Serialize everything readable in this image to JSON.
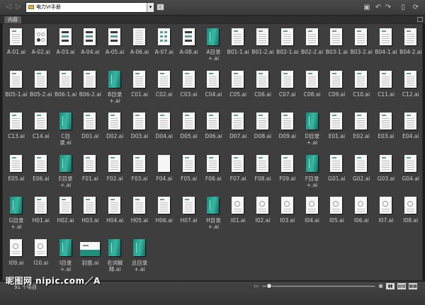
{
  "toolbar": {
    "back_icon": "back-arrow-icon",
    "forward_icon": "forward-arrow-icon",
    "path_value": "电力VI手册",
    "dropdown_glyph": "▾",
    "icons": [
      "new-folder-icon",
      "rotate-left-icon",
      "rotate-right-icon",
      "delete-icon",
      "refresh-icon"
    ]
  },
  "panel": {
    "tab_label": "内容"
  },
  "items": [
    {
      "name": "A-01.ai",
      "kind": "doc"
    },
    {
      "name": "A-02.ai",
      "kind": "circles"
    },
    {
      "name": "A-03.ai",
      "kind": "mini"
    },
    {
      "name": "A-04.ai",
      "kind": "mini"
    },
    {
      "name": "A-05.ai",
      "kind": "mini"
    },
    {
      "name": "A-06.ai",
      "kind": "lines"
    },
    {
      "name": "A-07.ai",
      "kind": "grid"
    },
    {
      "name": "A-08.ai",
      "kind": "mini"
    },
    {
      "name": "A目录\n+.ai",
      "kind": "teal"
    },
    {
      "name": "B01-1.ai",
      "kind": "doc"
    },
    {
      "name": "B01-2.ai",
      "kind": "doc"
    },
    {
      "name": "B02-1.ai",
      "kind": "doc"
    },
    {
      "name": "B02-2.ai",
      "kind": "doc"
    },
    {
      "name": "B03-1.ai",
      "kind": "doc"
    },
    {
      "name": "B03-2.ai",
      "kind": "doc"
    },
    {
      "name": "B04-1.ai",
      "kind": "doc"
    },
    {
      "name": "B04-2.ai",
      "kind": "doc"
    },
    {
      "name": "B05-1.ai",
      "kind": "doc"
    },
    {
      "name": "B05-2.ai",
      "kind": "doc"
    },
    {
      "name": "B06-1.ai",
      "kind": "doc"
    },
    {
      "name": "B06-2.ai",
      "kind": "doc"
    },
    {
      "name": "B目录\n+.ai",
      "kind": "teal"
    },
    {
      "name": "C01.ai",
      "kind": "doc"
    },
    {
      "name": "C02.ai",
      "kind": "doc"
    },
    {
      "name": "C03.ai",
      "kind": "doc"
    },
    {
      "name": "C04.ai",
      "kind": "doc"
    },
    {
      "name": "C05.ai",
      "kind": "doc"
    },
    {
      "name": "C06.ai",
      "kind": "doc"
    },
    {
      "name": "C07.ai",
      "kind": "doc"
    },
    {
      "name": "C08.ai",
      "kind": "doc"
    },
    {
      "name": "C09.ai",
      "kind": "doc"
    },
    {
      "name": "C10.ai",
      "kind": "doc"
    },
    {
      "name": "C11.ai",
      "kind": "doc"
    },
    {
      "name": "C12.ai",
      "kind": "doc"
    },
    {
      "name": "C13.ai",
      "kind": "doc"
    },
    {
      "name": "C14.ai",
      "kind": "doc"
    },
    {
      "name": "C目\n录.ai",
      "kind": "teal"
    },
    {
      "name": "D01.ai",
      "kind": "doc"
    },
    {
      "name": "D02.ai",
      "kind": "doc"
    },
    {
      "name": "D03.ai",
      "kind": "doc"
    },
    {
      "name": "D04.ai",
      "kind": "doc"
    },
    {
      "name": "D05.ai",
      "kind": "doc"
    },
    {
      "name": "D06.ai",
      "kind": "doc"
    },
    {
      "name": "D07.ai",
      "kind": "doc"
    },
    {
      "name": "D08.ai",
      "kind": "doc"
    },
    {
      "name": "D09.ai",
      "kind": "doc"
    },
    {
      "name": "D目录\n+.ai",
      "kind": "teal"
    },
    {
      "name": "E01.ai",
      "kind": "doc"
    },
    {
      "name": "E02.ai",
      "kind": "doc"
    },
    {
      "name": "E03.ai",
      "kind": "doc"
    },
    {
      "name": "E04.ai",
      "kind": "doc"
    },
    {
      "name": "E05.ai",
      "kind": "doc"
    },
    {
      "name": "E06.ai",
      "kind": "doc"
    },
    {
      "name": "E目录\n+.ai",
      "kind": "teal"
    },
    {
      "name": "F01.ai",
      "kind": "doc"
    },
    {
      "name": "F02.ai",
      "kind": "doc"
    },
    {
      "name": "F03.ai",
      "kind": "doc"
    },
    {
      "name": "F04.ai",
      "kind": "blank"
    },
    {
      "name": "F05.ai",
      "kind": "doc"
    },
    {
      "name": "F06.ai",
      "kind": "doc"
    },
    {
      "name": "F07.ai",
      "kind": "doc"
    },
    {
      "name": "F08.ai",
      "kind": "doc"
    },
    {
      "name": "F09.ai",
      "kind": "doc"
    },
    {
      "name": "F目录\n+.ai",
      "kind": "teal"
    },
    {
      "name": "G01.ai",
      "kind": "doc"
    },
    {
      "name": "G02.ai",
      "kind": "doc"
    },
    {
      "name": "G03.ai",
      "kind": "doc"
    },
    {
      "name": "G04.ai",
      "kind": "doc"
    },
    {
      "name": "G目录\n+.ai",
      "kind": "teal"
    },
    {
      "name": "H01.ai",
      "kind": "doc"
    },
    {
      "name": "H02.ai",
      "kind": "doc"
    },
    {
      "name": "H03.ai",
      "kind": "doc"
    },
    {
      "name": "H04.ai",
      "kind": "doc"
    },
    {
      "name": "H05.ai",
      "kind": "doc"
    },
    {
      "name": "H06.ai",
      "kind": "doc"
    },
    {
      "name": "H07.ai",
      "kind": "doc"
    },
    {
      "name": "H目录\n+.ai",
      "kind": "teal"
    },
    {
      "name": "I01.ai",
      "kind": "sketch"
    },
    {
      "name": "I02.ai",
      "kind": "sketch"
    },
    {
      "name": "I03.ai",
      "kind": "sketch"
    },
    {
      "name": "I04.ai",
      "kind": "sketch"
    },
    {
      "name": "I05.ai",
      "kind": "sketch"
    },
    {
      "name": "I06.ai",
      "kind": "sketch"
    },
    {
      "name": "I07.ai",
      "kind": "sketch"
    },
    {
      "name": "I08.ai",
      "kind": "sketch"
    },
    {
      "name": "I09.ai",
      "kind": "sketch"
    },
    {
      "name": "I10.ai",
      "kind": "sketch"
    },
    {
      "name": "I目录\n+.ai",
      "kind": "teal"
    },
    {
      "name": "封面.ai",
      "kind": "cover"
    },
    {
      "name": "名词解\n释.ai",
      "kind": "teal"
    },
    {
      "name": "总目录\n+.ai",
      "kind": "teal"
    }
  ],
  "status": {
    "count_text": "91 个项目",
    "watermark": "昵图网 nipic.com／A",
    "zoom_out_icon": "zoom-out-icon",
    "zoom_in_icon": "zoom-in-icon",
    "view_buttons": [
      "thumbnail-view-button",
      "list-view-button",
      "details-view-button"
    ],
    "view_glyphs": [
      "▮▮",
      "▤▤",
      "▦▦"
    ],
    "zoom_level": 0.05
  },
  "colors": {
    "background": "#3e3e3e",
    "thumbnail_accent": "#1f9a87",
    "toolbar": "#4a4a4a"
  }
}
